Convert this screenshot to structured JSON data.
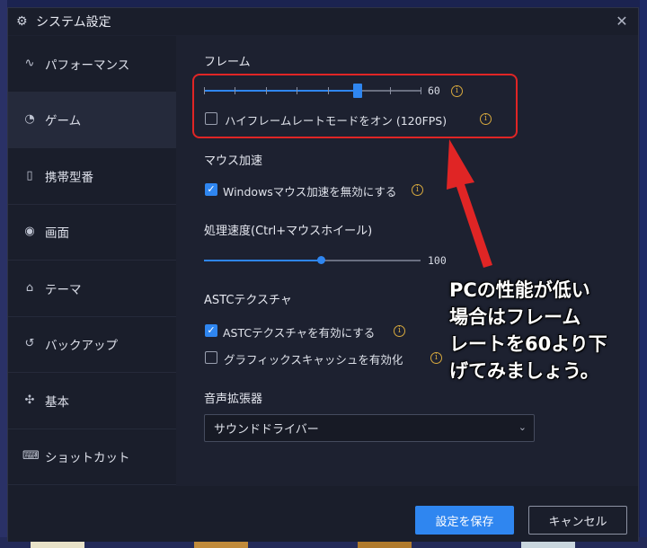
{
  "window": {
    "title": "システム設定",
    "close_glyph": "✕"
  },
  "sidebar": {
    "items": [
      {
        "label": "パフォーマンス",
        "icon": "pulse-icon"
      },
      {
        "label": "ゲーム",
        "icon": "gamepad-icon"
      },
      {
        "label": "携帯型番",
        "icon": "phone-icon"
      },
      {
        "label": "画面",
        "icon": "display-icon"
      },
      {
        "label": "テーマ",
        "icon": "shirt-icon"
      },
      {
        "label": "バックアップ",
        "icon": "history-icon"
      },
      {
        "label": "基本",
        "icon": "puzzle-icon"
      },
      {
        "label": "ショットカット",
        "icon": "keyboard-icon"
      }
    ],
    "active_index": 1
  },
  "frame": {
    "title": "フレーム",
    "slider_value": "60",
    "slider_fraction": 0.71,
    "high_frame_label": "ハイフレームレートモードをオン (120FPS)",
    "high_frame_checked": false
  },
  "mouse": {
    "title": "マウス加速",
    "disable_label": "Windowsマウス加速を無効にする",
    "disable_checked": true
  },
  "processing": {
    "title": "処理速度(Ctrl+マウスホイール)",
    "slider_value": "100",
    "slider_fraction": 0.54
  },
  "astc": {
    "title": "ASTCテクスチャ",
    "enable_label": "ASTCテクスチャを有効にする",
    "enable_checked": true,
    "cache_label": "グラフィックスキャッシュを有効化",
    "cache_checked": false
  },
  "audio": {
    "title": "音声拡張器",
    "selected": "サウンドドライバー"
  },
  "footer": {
    "save_label": "設定を保存",
    "cancel_label": "キャンセル"
  },
  "annotation": {
    "lines": [
      "PCの性能が低い",
      "場合はフレーム",
      "レートを60より下",
      "げてみましょう。"
    ]
  },
  "colors": {
    "accent": "#2f86f0",
    "highlight": "#e02525",
    "info": "#d7a93e"
  }
}
